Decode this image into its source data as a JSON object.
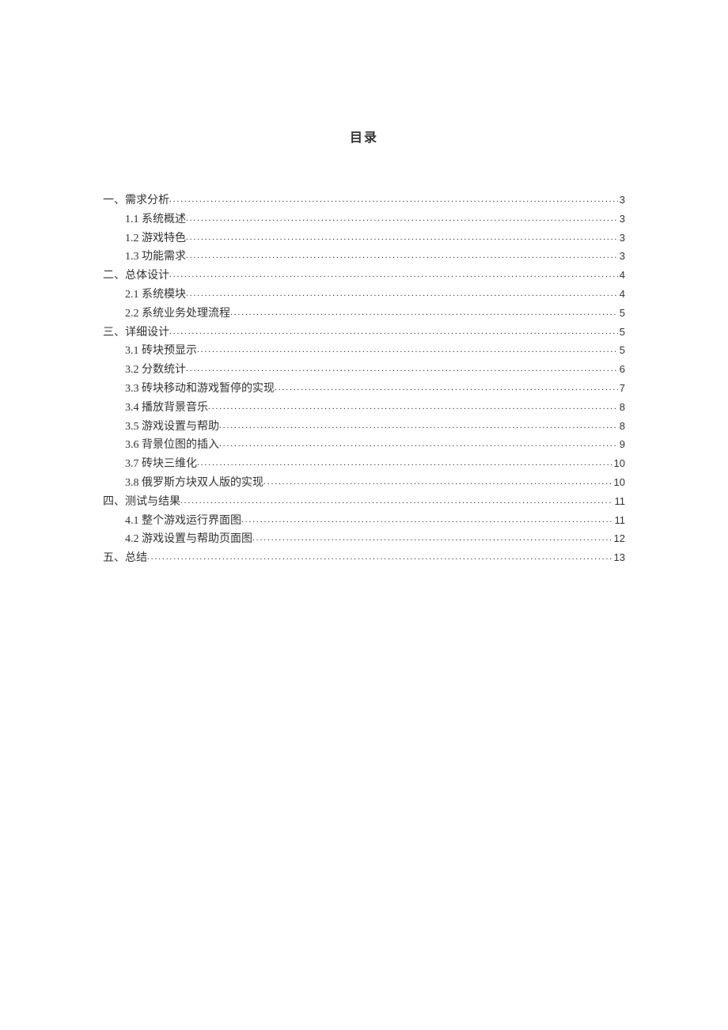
{
  "title": "目录",
  "toc": [
    {
      "level": 1,
      "label": "一、需求分析",
      "page": "3"
    },
    {
      "level": 2,
      "label": "1.1 系统概述",
      "page": "3"
    },
    {
      "level": 2,
      "label": "1.2 游戏特色",
      "page": "3"
    },
    {
      "level": 2,
      "label": "1.3 功能需求",
      "page": "3"
    },
    {
      "level": 1,
      "label": "二、总体设计",
      "page": "4"
    },
    {
      "level": 2,
      "label": "2.1 系统模块",
      "page": "4"
    },
    {
      "level": 2,
      "label": "2.2 系统业务处理流程",
      "page": "5"
    },
    {
      "level": 1,
      "label": "三、详细设计",
      "page": "5"
    },
    {
      "level": 2,
      "label": "3.1 砖块预显示",
      "page": "5"
    },
    {
      "level": 2,
      "label": "3.2 分数统计",
      "page": "6"
    },
    {
      "level": 2,
      "label": "3.3 砖块移动和游戏暂停的实现",
      "page": "7"
    },
    {
      "level": 2,
      "label": "3.4 播放背景音乐",
      "page": "8"
    },
    {
      "level": 2,
      "label": "3.5 游戏设置与帮助",
      "page": "8"
    },
    {
      "level": 2,
      "label": "3.6 背景位图的插入",
      "page": "9"
    },
    {
      "level": 2,
      "label": "3.7 砖块三维化",
      "page": "10"
    },
    {
      "level": 2,
      "label": "3.8 俄罗斯方块双人版的实现",
      "page": "10"
    },
    {
      "level": 1,
      "label": "四、测试与结果",
      "page": "11"
    },
    {
      "level": 2,
      "label": "4.1 整个游戏运行界面图",
      "page": "11"
    },
    {
      "level": 2,
      "label": "4.2 游戏设置与帮助页面图",
      "page": "12"
    },
    {
      "level": 1,
      "label": "五、总结",
      "page": "13"
    }
  ]
}
